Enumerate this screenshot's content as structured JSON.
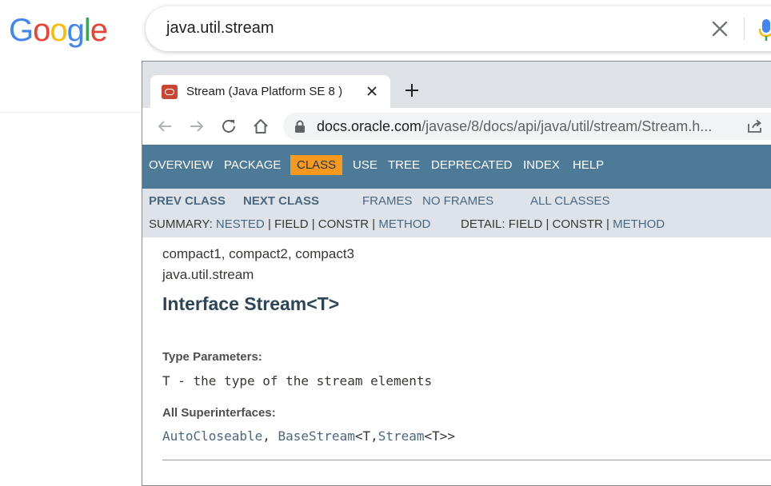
{
  "google": {
    "logo_letters": [
      {
        "ch": "G",
        "color": "#4285F4"
      },
      {
        "ch": "o",
        "color": "#EA4335"
      },
      {
        "ch": "o",
        "color": "#FBBC05"
      },
      {
        "ch": "g",
        "color": "#4285F4"
      },
      {
        "ch": "l",
        "color": "#34A853"
      },
      {
        "ch": "e",
        "color": "#EA4335"
      }
    ],
    "search_value": "java.util.stream",
    "clear_icon": "close-icon",
    "mic_icon": "microphone-icon"
  },
  "browser": {
    "tab_title": "Stream (Java Platform SE 8 )",
    "favicon": "oracle-icon",
    "url_host": "docs.oracle.com",
    "url_path": "/javase/8/docs/api/java/util/stream/Stream.h..."
  },
  "javadoc": {
    "nav": [
      "OVERVIEW",
      "PACKAGE",
      "CLASS",
      "USE",
      "TREE",
      "DEPRECATED",
      "INDEX",
      "HELP"
    ],
    "active_nav": "CLASS",
    "subnav": {
      "prev_class": "PREV CLASS",
      "next_class": "NEXT CLASS",
      "frames": "FRAMES",
      "no_frames": "NO FRAMES",
      "all_classes": "ALL CLASSES",
      "summary_label": "SUMMARY:",
      "summary_nested": "NESTED",
      "summary_field": "FIELD",
      "summary_constr": "CONSTR",
      "summary_method": "METHOD",
      "detail_label": "DETAIL:",
      "detail_field": "FIELD",
      "detail_constr": "CONSTR",
      "detail_method": "METHOD",
      "sep": "|"
    },
    "profiles": "compact1, compact2, compact3",
    "package": "java.util.stream",
    "title": "Interface Stream<T>",
    "type_params_label": "Type Parameters:",
    "type_params_value": "T - the type of the stream elements",
    "superinterfaces_label": "All Superinterfaces:",
    "super_1": "AutoCloseable",
    "super_comma": ", ",
    "super_2": "BaseStream",
    "super_mid": "<T,",
    "super_3": "Stream",
    "super_end": "<T>>"
  },
  "colors": {
    "nav_bg": "#4d7a97",
    "active_tab_bg": "#f8981d",
    "subnav_bg": "#dee3e9",
    "link": "#4a6782",
    "title": "#2c4557"
  }
}
